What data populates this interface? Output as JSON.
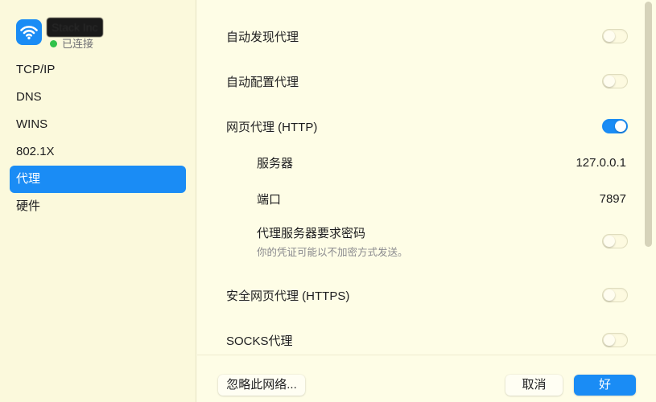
{
  "network": {
    "name": "Stack Inc",
    "status": "已连接"
  },
  "sidebar": {
    "items": [
      {
        "label": "TCP/IP"
      },
      {
        "label": "DNS"
      },
      {
        "label": "WINS"
      },
      {
        "label": "802.1X"
      },
      {
        "label": "代理"
      },
      {
        "label": "硬件"
      }
    ],
    "active": "代理"
  },
  "proxy": {
    "auto_discovery": {
      "label": "自动发现代理",
      "enabled": false
    },
    "auto_config": {
      "label": "自动配置代理",
      "enabled": false
    },
    "http": {
      "label": "网页代理 (HTTP)",
      "enabled": true
    },
    "server": {
      "label": "服务器",
      "value": "127.0.0.1"
    },
    "port": {
      "label": "端口",
      "value": "7897"
    },
    "password": {
      "label": "代理服务器要求密码",
      "hint": "你的凭证可能以不加密方式发送。",
      "enabled": false
    },
    "https": {
      "label": "安全网页代理 (HTTPS)",
      "enabled": false
    },
    "socks": {
      "label": "SOCKS代理",
      "enabled": false
    }
  },
  "footer": {
    "ignore_label": "忽略此网络...",
    "cancel_label": "取消",
    "ok_label": "好"
  },
  "colors": {
    "accent": "#1a8cf5",
    "status_connected": "#30c24a",
    "background": "#fefde6"
  }
}
